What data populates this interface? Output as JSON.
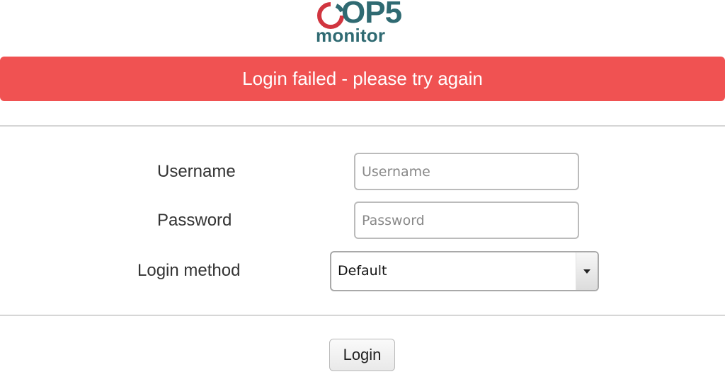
{
  "logo": {
    "brand": "OP5",
    "product": "monitor",
    "colors": {
      "ring": "#d1353f",
      "text": "#2f6a72"
    }
  },
  "alert": {
    "message": "Login failed - please try again",
    "color": "#f05252"
  },
  "form": {
    "username": {
      "label": "Username",
      "placeholder": "Username",
      "value": ""
    },
    "password": {
      "label": "Password",
      "placeholder": "Password",
      "value": ""
    },
    "login_method": {
      "label": "Login method",
      "selected": "Default",
      "icon": "chevron-down-icon"
    }
  },
  "actions": {
    "login_label": "Login"
  }
}
